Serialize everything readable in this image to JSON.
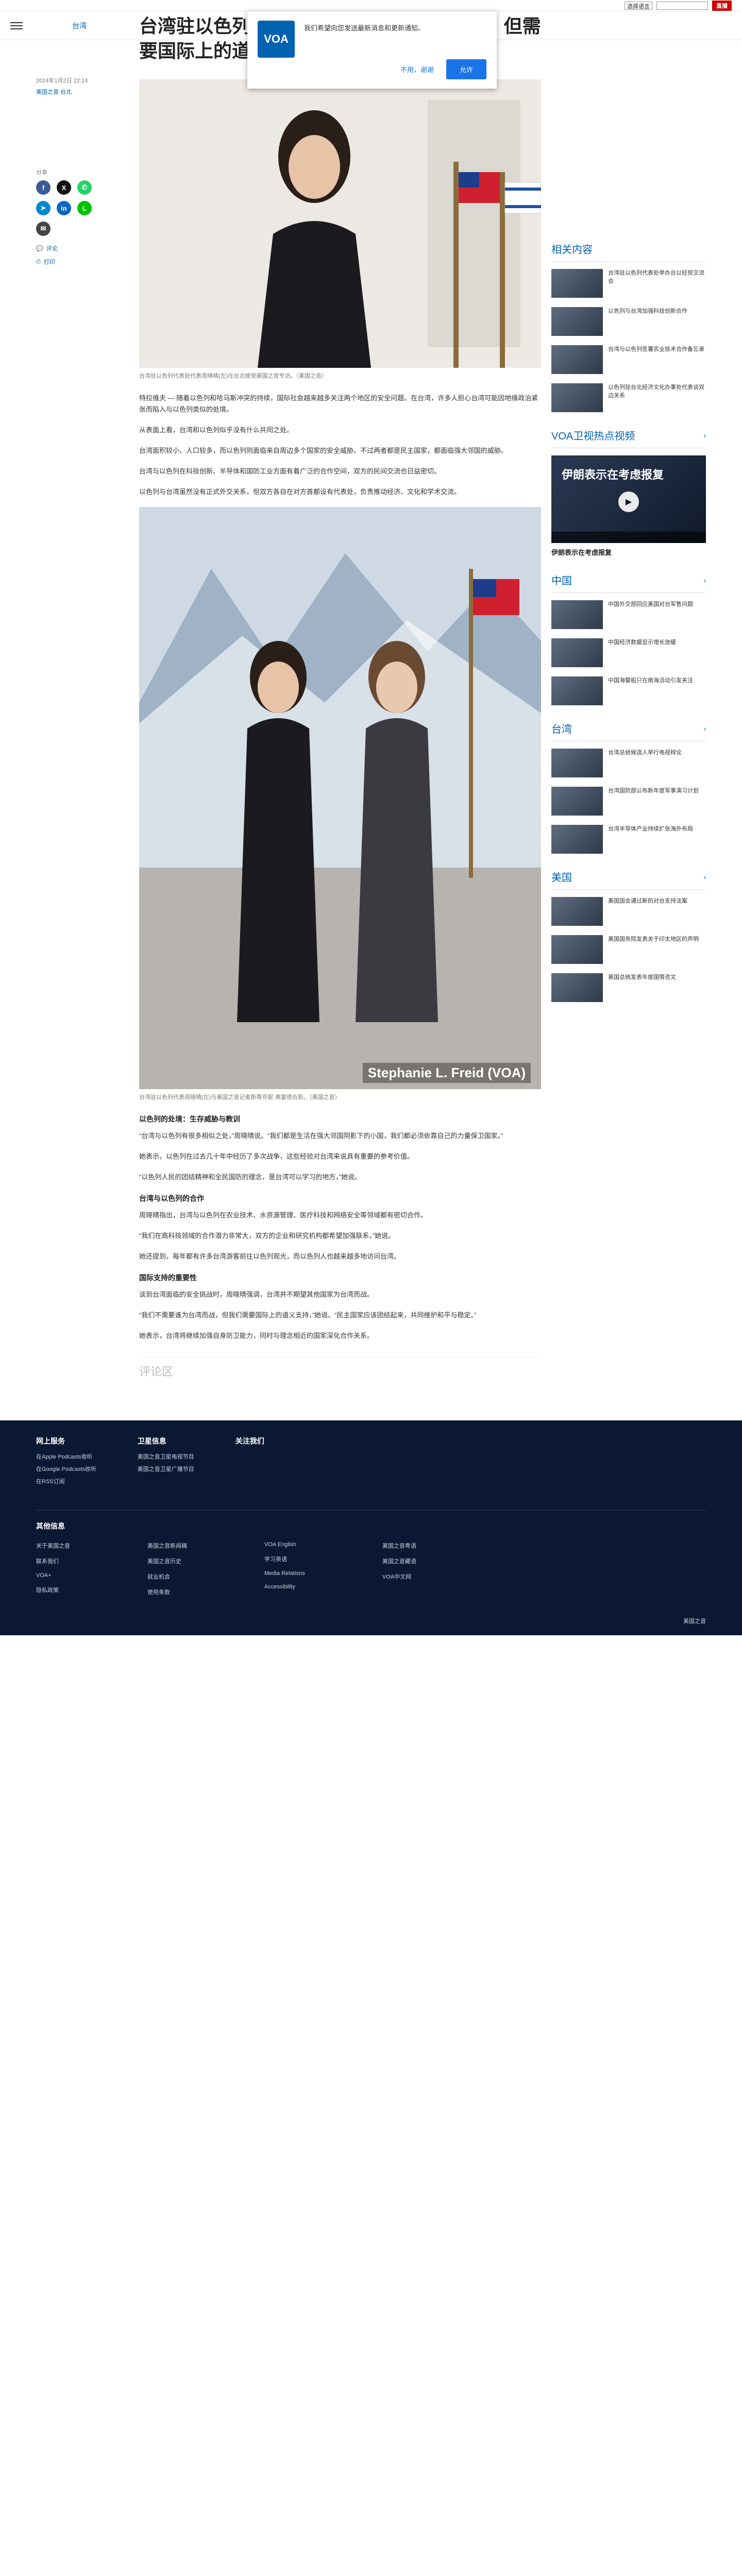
{
  "util_bar": {
    "language": "选择语言",
    "live_label": "直播"
  },
  "header": {
    "section": "台湾"
  },
  "notification": {
    "logo": "VOA",
    "text": "我们希望向您发送最新消息和更新通知。",
    "later_label": "不用，谢谢",
    "allow_label": "允许"
  },
  "article": {
    "title": "台湾驻以色列代表：“不要将谁为台湾而战，但需要国际上的道义支持”",
    "date": "2024年1月2日 22:14",
    "author": "美国之音 台北",
    "share_label": "分享",
    "left_links": [
      "评论",
      "打印"
    ],
    "caption1": "台湾驻以色列代表处代表周晓晴(左)在台北接受美国之音专访。（美国之音）",
    "paragraphs1": [
      "特拉维夫 — 随着以色列和哈马斯冲突的持续，国际社会越来越多关注两个地区的安全问题。在台湾，许多人担心台湾可能因地缘政治紧张而陷入与以色列类似的处境。",
      "从表面上看，台湾和以色列似乎没有什么共同之处。",
      "台湾面积较小、人口较多，而以色列则面临来自周边多个国家的安全威胁。不过两者都是民主国家，都面临强大邻国的威胁。",
      "台湾与以色列在科技创新、半导体和国防工业方面有着广泛的合作空间，双方的民间交流也日益密切。",
      "以色列与台湾虽然没有正式外交关系，但双方各自在对方首都设有代表处，负责推动经济、文化和学术交流。"
    ],
    "photo_credit": "Stephanie L. Freid (VOA)",
    "caption2": "台湾驻以色列代表周晓晴(左)与美国之音记者斯蒂芬妮·弗雷德合影。（美国之音）",
    "sections": [
      {
        "heading": "以色列的处境：生存威胁与教训",
        "paragraphs": [
          "“台湾与以色列有很多相似之处，”周晓晴说。“我们都是生活在强大邻国阴影下的小国，我们都必须依靠自己的力量保卫国家。”",
          "她表示，以色列在过去几十年中经历了多次战争，这些经验对台湾来说具有重要的参考价值。",
          "“以色列人民的团结精神和全民国防的理念，是台湾可以学习的地方，”她说。"
        ]
      },
      {
        "heading": "台湾与以色列的合作",
        "paragraphs": [
          "周晓晴指出，台湾与以色列在农业技术、水资源管理、医疗科技和网络安全等领域都有密切合作。",
          "“我们在高科技领域的合作潜力非常大，双方的企业和研究机构都希望加强联系，”她说。",
          "她还提到，每年都有许多台湾游客前往以色列观光，而以色列人也越来越多地访问台湾。"
        ]
      },
      {
        "heading": "国际支持的重要性",
        "paragraphs": [
          "谈到台湾面临的安全挑战时，周晓晴强调，台湾并不期望其他国家为台湾而战。",
          "“我们不需要谁为台湾而战，但我们需要国际上的道义支持，”她说。“民主国家应该团结起来，共同维护和平与稳定。”",
          "她表示，台湾将继续加强自身防卫能力，同时与理念相近的国家深化合作关系。"
        ]
      }
    ],
    "comments_label": "评论区"
  },
  "sidebar": {
    "related_title": "相关内容",
    "related": [
      "台湾驻以色列代表处举办台以经贸交流会",
      "以色列与台湾加强科技创新合作",
      "台湾与以色列签署农业技术合作备忘录",
      "以色列驻台北经济文化办事处代表谈双边关系"
    ],
    "video_section": "VOA卫视热点视频",
    "video_title": "伊朗表示在考虑报复",
    "video_label": "伊朗表示在考虑报复",
    "china_title": "中国",
    "china": [
      "中国外交部回应美国对台军售问题",
      "中国经济数据显示增长放缓",
      "中国海警船只在南海活动引发关注"
    ],
    "taiwan_title": "台湾",
    "taiwan": [
      "台湾总统候选人举行电视辩论",
      "台湾国防部公布新年度军事演习计划",
      "台湾半导体产业持续扩张海外布局"
    ],
    "us_title": "美国",
    "us": [
      "美国国会通过新的对台支持法案",
      "美国国务院发表关于印太地区的声明",
      "美国总统发表年度国情咨文"
    ]
  },
  "footer": {
    "col1_title": "网上服务",
    "col1": [
      "在Apple Podcasts收听",
      "在Google Podcasts收听",
      "在RSS订阅"
    ],
    "col2_title": "卫星信息",
    "col2": [
      "美国之音卫星电视节目",
      "美国之音卫星广播节目"
    ],
    "col3_title": "关注我们",
    "more_title": "其他信息",
    "links_col1": [
      "关于美国之音",
      "联系我们",
      "VOA+",
      "隐私政策"
    ],
    "links_col2": [
      "美国之音新闻稿",
      "美国之音历史",
      "就业机会",
      "使用条款"
    ],
    "links_col3": [
      "VOA English",
      "学习英语",
      "Media Relations",
      "Accessibility"
    ],
    "links_col4": [
      "美国之音粤语",
      "美国之音藏语",
      "VOA中文网"
    ],
    "bottom_text": "美国之音"
  }
}
